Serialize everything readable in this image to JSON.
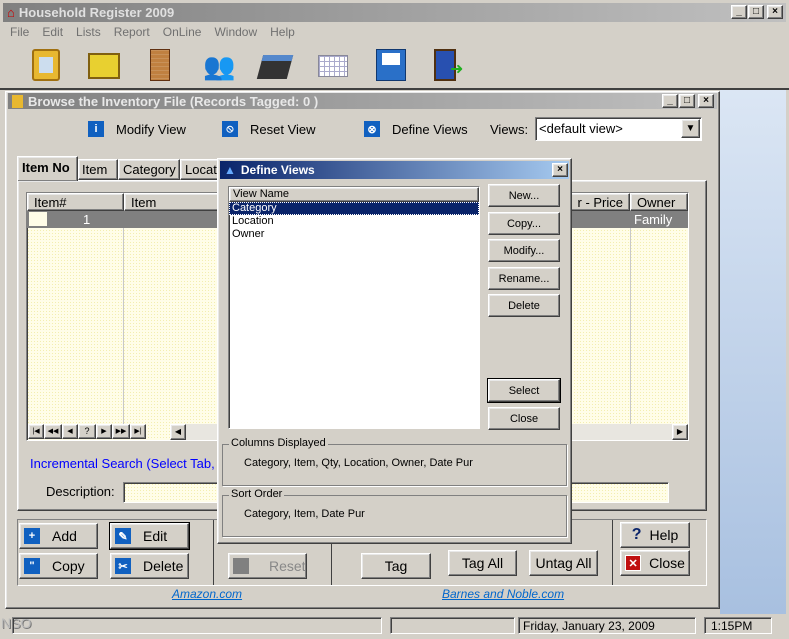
{
  "app": {
    "title": "Household Register 2009",
    "menu": [
      "File",
      "Edit",
      "Lists",
      "Report",
      "OnLine",
      "Window",
      "Help"
    ],
    "toolbar_icons": [
      "clipboard-icon",
      "file-drawer-icon",
      "building-icon",
      "people-icon",
      "calculator-icon",
      "calendar-icon",
      "floppy-disk-icon",
      "exit-door-icon"
    ]
  },
  "child": {
    "title": "Browse the Inventory File  (Records Tagged:  0 )",
    "modify_view": "Modify View",
    "reset_view": "Reset View",
    "define_views": "Define Views",
    "views_label": "Views:",
    "views_value": "<default view>",
    "tabs": [
      "Item No",
      "Item",
      "Category",
      "Locat"
    ],
    "grid": {
      "headers": [
        "Item#",
        "Item",
        "r - Price",
        "Owner"
      ],
      "row": {
        "item_no": "1",
        "owner": "Family"
      }
    },
    "nav": [
      "|◀",
      "◀◀",
      "◀",
      "?",
      "▶",
      "▶▶",
      "▶|"
    ],
    "incremental": "Incremental Search (Select Tab, cl",
    "description_label": "Description:",
    "buttons": {
      "add": "Add",
      "edit": "Edit",
      "copy": "Copy",
      "delete": "Delete",
      "reset": "Reset",
      "tag": "Tag",
      "tag_all": "Tag All",
      "untag_all": "Untag All",
      "help": "Help",
      "close": "Close"
    },
    "links": {
      "amazon": "Amazon.com",
      "bn": "Barnes and Noble.com"
    }
  },
  "dialog": {
    "title": "Define Views",
    "list_header": "View Name",
    "views": [
      "Category",
      "Location",
      "Owner"
    ],
    "selected": 0,
    "buttons": [
      "New...",
      "Copy...",
      "Modify...",
      "Rename...",
      "Delete",
      "Select",
      "Close"
    ],
    "columns_label": "Columns Displayed",
    "columns": "Category, Item, Qty, Location, Owner, Date Pur",
    "sort_label": "Sort Order",
    "sort": "Category,  Item, Date Pur"
  },
  "status": {
    "left": "NSO",
    "date": "Friday, January 23, 2009",
    "time": "1:15PM"
  },
  "colors": {
    "dialog_title": "#0a246a",
    "link": "#0066cc",
    "search_text": "#0000ff",
    "selection": "#0a246a"
  }
}
